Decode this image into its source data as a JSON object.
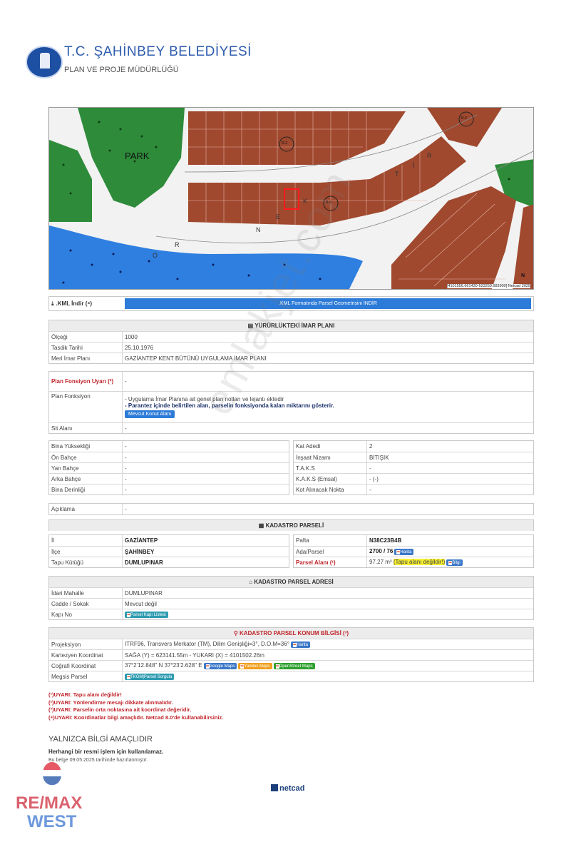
{
  "header": {
    "title": "T.C. ŞAHİNBEY BELEDİYESİ",
    "subtitle": "PLAN VE PROJE MÜDÜRLÜĞÜ",
    "seal_text": "GAZİANTEP ŞAHİNBEY BELEDİYESİ"
  },
  "map": {
    "labels": [
      "PARK",
      "R-2",
      "R-2",
      "R-2",
      "N",
      "E",
      "K",
      "T",
      "İ",
      "R",
      "O",
      "R",
      "N"
    ],
    "coords": "[4101556.661430-623250.683900] Netcad 2025",
    "north": "N"
  },
  "kml": {
    "label": ".KML İndir (⁴)",
    "button": ".KML Formatında Parsel Geometrisini İNDİR"
  },
  "imar": {
    "heading": "YÜRÜRLÜKTEKİ İMAR PLANI",
    "rows": [
      {
        "label": "Ölçeği",
        "value": "1000"
      },
      {
        "label": "Tasdik Tarihi",
        "value": "25.10.1976"
      },
      {
        "label": "Meri İmar Planı",
        "value": "GAZİANTEP KENT BÜTÜNÜ UYGULAMA İMAR PLANI"
      }
    ]
  },
  "fonksiyon": {
    "warn_label": "Plan Fonsiyon Uyarı (²)",
    "warn_value": "-",
    "label": "Plan Fonksiyon",
    "line1": "- Uygulama İmar Planına ait genel plan notları ve lejantı ektedir",
    "line2": "- Parantez içinde belirtilen alan, parselin fonksiyonda kalan miktarını gösterir.",
    "button": "Mevcut Konut Alanı",
    "sit_label": "Sit Alanı",
    "sit_value": "-"
  },
  "bina_left": [
    {
      "label": "Bina Yüksekliği",
      "value": "-"
    },
    {
      "label": "Ön Bahçe",
      "value": "-"
    },
    {
      "label": "Yan Bahçe",
      "value": "-"
    },
    {
      "label": "Arka Bahçe",
      "value": "-"
    },
    {
      "label": "Bina Derinliği",
      "value": "-"
    }
  ],
  "bina_right": [
    {
      "label": "Kat Adedi",
      "value": "2"
    },
    {
      "label": "İnşaat Nizamı",
      "value": "BITIŞIK"
    },
    {
      "label": "T.A.K.S",
      "value": "-"
    },
    {
      "label": "K.A.K.S (Emsal)",
      "value": "- (-)"
    },
    {
      "label": "Kot Alınacak Nokta",
      "value": "-"
    }
  ],
  "aciklama": {
    "label": "Açıklama",
    "value": "-"
  },
  "kadastro": {
    "heading": "KADASTRO PARSELİ",
    "il_label": "İl",
    "il": "GAZİANTEP",
    "ilce_label": "İlçe",
    "ilce": "ŞAHİNBEY",
    "tapu_label": "Tapu Kütüğü",
    "tapu": "DUMLUPINAR",
    "pafta_label": "Pafta",
    "pafta": "N38C23B4B",
    "ada_label": "Ada/Parsel",
    "ada": "2700 / 76",
    "ada_btn": "Harita",
    "alan_label": "Parsel Alanı (¹)",
    "alan": "97.27 m²",
    "alan_note": "(Tapu alanı değildir!)",
    "alan_btn": "Bilgi"
  },
  "adres": {
    "heading": "KADASTRO PARSEL ADRESİ",
    "mahalle_label": "İdari Mahalle",
    "mahalle": "DUMLUPINAR",
    "cadde_label": "Cadde / Sokak",
    "cadde": "Mevcut değil",
    "kapi_label": "Kapı No",
    "kapi_btn": "Parsel Kapı Listesi"
  },
  "konum": {
    "heading": "KADASTRO PARSEL KONUM BİLGİSİ (³)",
    "proj_label": "Projeksiyon",
    "proj": "ITRF96, Transvers Merkator (TM), Dilim Genişliği=3°, D.O.M=36°",
    "proj_btn": "Harita",
    "kart_label": "Kartezyen Koordinat",
    "kart": "SAĞA (Y) = 623141.55m - YUKARI (X) = 4101502.26m",
    "cog_label": "Coğrafi Koordinat",
    "cog": "37°2'12.848\" N 37°23'2.628\" E",
    "btn_google": "Google Maps",
    "btn_yandex": "Yandex Maps",
    "btn_osm": "OpenStreet Maps",
    "megsis_label": "Megsis Parsel",
    "megsis_btn": "TKGM|Parsel Sorgula"
  },
  "warnings": [
    "(¹)UYARI: Tapu alanı değildir!",
    "(²)UYARI: Yönlendirme mesajı dikkate alınmalıdır.",
    "(³)UYARI: Parselin orta noktasına ait koordinat değeridir.",
    "(⁴)UYARI: Koordinatlar bilgi amaçlıdır. Netcad 8.0'de kullanabilirsiniz."
  ],
  "footer": {
    "line1": "YALNIZCA BİLGİ AMAÇLIDIR",
    "line2": "Herhangi bir resmi işlem için kullanılamaz.",
    "line3": "Bu belge 09.05.2025 tarihinde hazırlanmıştır.",
    "netcad": "netcad"
  },
  "watermark": "emlakjet.com",
  "remax": {
    "balloon_text": "RE/MAX",
    "line1": "RE/MAX",
    "line2": "WEST"
  },
  "colors": {
    "brown": "#a0492f",
    "green": "#2e8b3a",
    "blue": "#2f7fe0",
    "link_blue": "#2d7bd8"
  }
}
